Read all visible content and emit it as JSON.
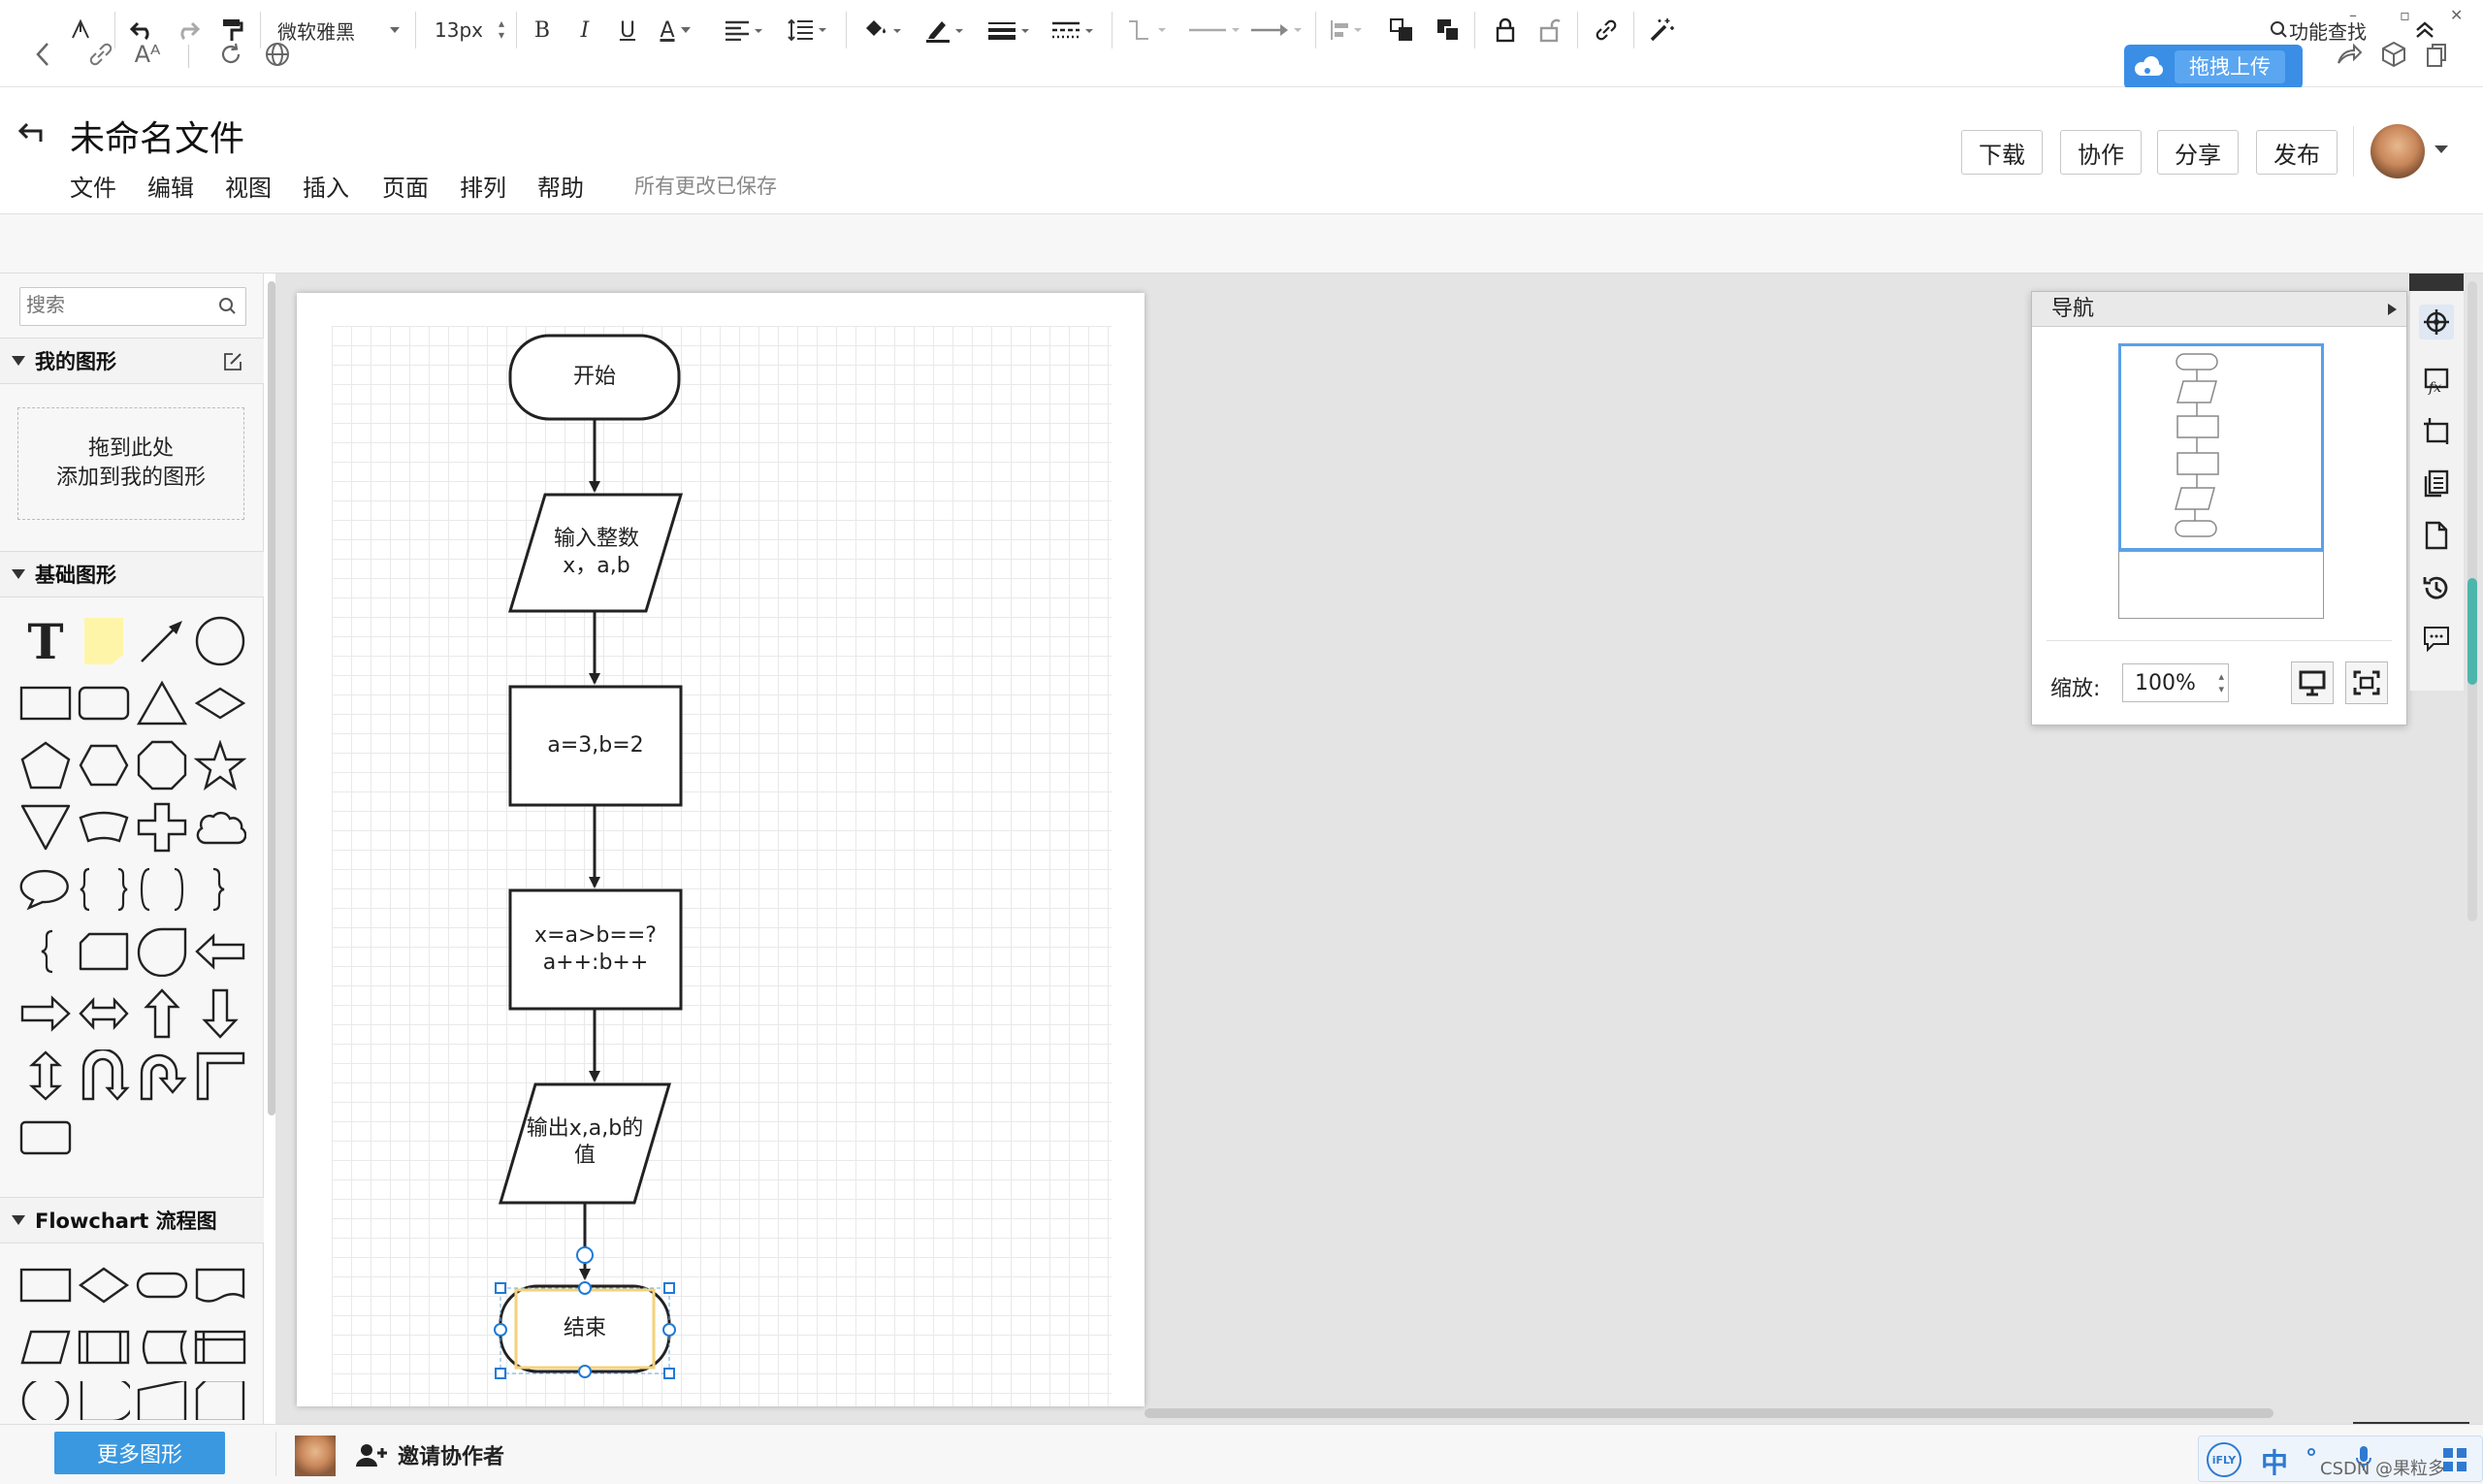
{
  "browser": {
    "upload_label": "拖拽上传",
    "window_controls": [
      "–",
      "▫",
      "✕"
    ]
  },
  "header": {
    "title": "未命名文件",
    "menu": [
      "文件",
      "编辑",
      "视图",
      "插入",
      "页面",
      "排列",
      "帮助"
    ],
    "save_status": "所有更改已保存",
    "buttons": {
      "download": "下载",
      "collaborate": "协作",
      "share": "分享",
      "publish": "发布"
    }
  },
  "toolbar": {
    "font_family": "微软雅黑",
    "font_size": "13px",
    "bold": "B",
    "italic": "I",
    "underline": "U",
    "font_color": "A",
    "feature_search": "功能查找"
  },
  "sidebar": {
    "search_placeholder": "搜索",
    "my_shapes": "我的图形",
    "drop_hint_line1": "拖到此处",
    "drop_hint_line2": "添加到我的图形",
    "basic_shapes": "基础图形",
    "text_shape": "T",
    "flowchart": "Flowchart 流程图",
    "more_shapes": "更多图形"
  },
  "flowchart": {
    "start": "开始",
    "input_line1": "输入整数",
    "input_line2": "x，a,b",
    "assign": "a=3,b=2",
    "process_line1": "x=a>b==?",
    "process_line2": "a++:b++",
    "output_line1": "输出x,a,b的",
    "output_line2": "值",
    "end": "结束"
  },
  "navigator": {
    "title": "导航",
    "zoom_label": "缩放:",
    "zoom_value": "100%"
  },
  "bottom": {
    "invite": "邀请协作者",
    "ime_label": "中",
    "ime_brand": "iFLY",
    "watermark": "CSDN @果粒多"
  },
  "colors": {
    "accent": "#3a98e0",
    "selection": "#1f7ad8",
    "nav_highlight": "#5aa0e8",
    "edit_highlight": "#f5d27a"
  }
}
